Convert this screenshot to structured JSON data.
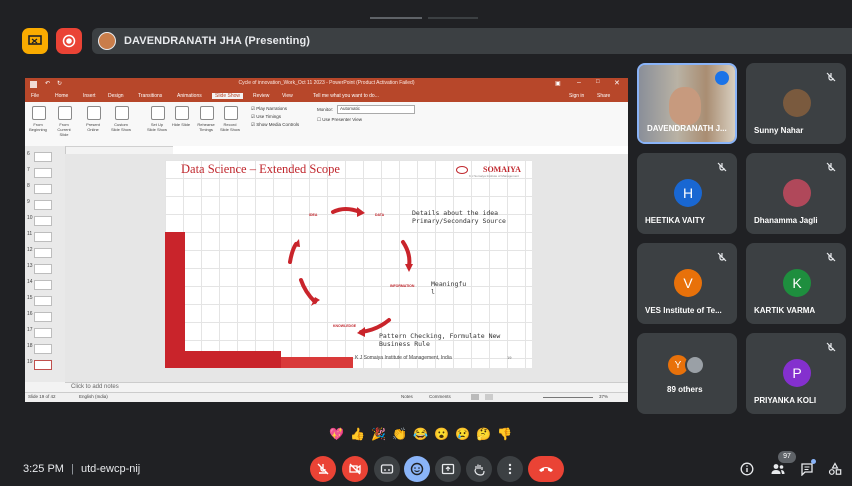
{
  "presenting": {
    "label": "DAVENDRANATH JHA (Presenting)"
  },
  "ppt": {
    "title": "Cycle of innovation_Work_Oct 11 2023 - PowerPoint (Product Activation Failed)",
    "menu": [
      "File",
      "Home",
      "Insert",
      "Design",
      "Transitions",
      "Animations",
      "Slide Show",
      "Review",
      "View",
      "Tell me what you want to do..."
    ],
    "active_tab": "Slide Show",
    "sign_in": "Sign in",
    "share": "Share",
    "ribbon": [
      "From Beginning",
      "From Current Slide",
      "Present Online",
      "Custom Slide Show",
      "Set Up Slide Show",
      "Hide Slide",
      "Rehearse Timings",
      "Record Slide Show"
    ],
    "ribbon_checks": [
      "Play Narrations",
      "Use Timings",
      "Show Media Controls"
    ],
    "monitor_label": "Monitor:",
    "monitor_value": "Automatic",
    "presenter_view": "Use Presenter View",
    "thumb_nums": [
      "6",
      "7",
      "8",
      "9",
      "10",
      "11",
      "12",
      "13",
      "14",
      "15",
      "16",
      "17",
      "18",
      "19"
    ],
    "notes_placeholder": "Click to add notes",
    "status_slide": "Slide 19 of 42",
    "status_lang": "English (India)",
    "status_notes": "Notes",
    "status_comments": "Comments",
    "status_zoom": "37%"
  },
  "slide": {
    "title": "Data Science – Extended Scope",
    "logo": "SOMAIYA",
    "logo_sub": "K J Somaiya Institute of Management",
    "cycle_labels": [
      "IDEA",
      "DATA",
      "INFORMATION",
      "KNOWLEDGE"
    ],
    "note1": "Details about the idea Primary/Secondary Source",
    "note2": "Meaningfu l",
    "note3": "Pattern Checking, Formulate New Business Rule",
    "footer": "K J Somaiya Institute of Management, India",
    "page": "19"
  },
  "participants": [
    {
      "name": "DAVENDRANATH J...",
      "initial": "",
      "color": "#5b6b8a",
      "speaking": true
    },
    {
      "name": "Sunny Nahar",
      "initial": "",
      "color": "#7a5a3e"
    },
    {
      "name": "HEETIKA VAITY",
      "initial": "H",
      "color": "#1967d2"
    },
    {
      "name": "Dhanamma Jagli",
      "initial": "",
      "color": "#b0485a"
    },
    {
      "name": "VES Institute of Te...",
      "initial": "V",
      "color": "#e8710a"
    },
    {
      "name": "KARTIK VARMA",
      "initial": "K",
      "color": "#1e8e3e"
    },
    {
      "name": "89 others",
      "initial": "Y",
      "color": "#e8710a"
    },
    {
      "name": "PRIYANKA KOLI",
      "initial": "P",
      "color": "#8430ce"
    }
  ],
  "reactions": [
    "💖",
    "👍",
    "🎉",
    "👏",
    "😂",
    "😮",
    "😢",
    "🤔",
    "👎"
  ],
  "footer": {
    "time": "3:25 PM",
    "separator": "|",
    "meeting_code": "utd-ewcp-nij",
    "people_count": "97"
  },
  "colors": {
    "accent": "#8ab4f8",
    "danger": "#ea4335",
    "ppt": "#b7472a",
    "slide_red": "#c9242b"
  }
}
